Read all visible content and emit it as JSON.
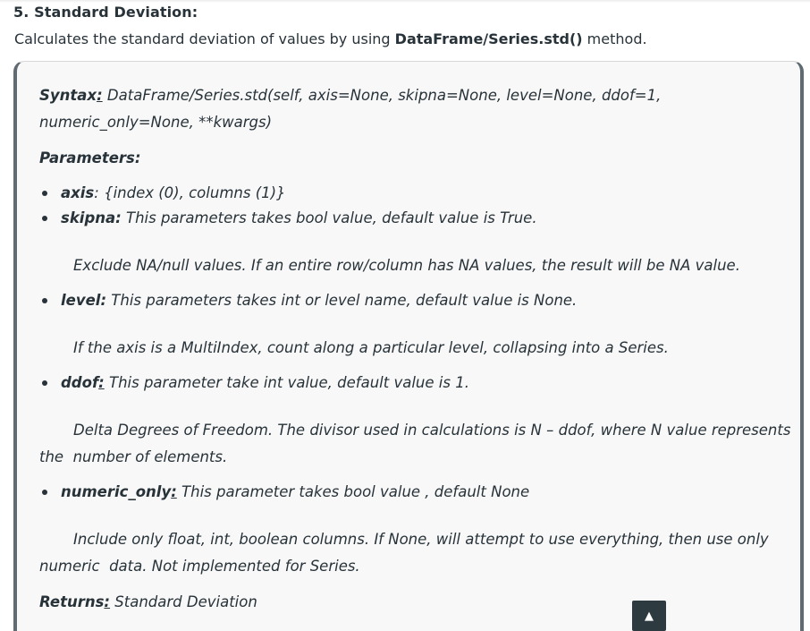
{
  "section": {
    "title": "5. Standard Deviation:",
    "intro_before": "Calculates the standard deviation of values by using ",
    "intro_code": "DataFrame/Series.std()",
    "intro_after": " method."
  },
  "syntax": {
    "label": "Syntax",
    "colon": ":",
    "line1": " DataFrame/Series.std(self, axis=None, skipna=None, level=None, ddof=1,",
    "line2": "numeric_only=None, **kwargs)"
  },
  "parameters_label": "Parameters:",
  "params": [
    {
      "name": "axis",
      "sep": ":",
      "text": " {index (0), columns (1)}"
    },
    {
      "name": "skipna:",
      "sep": "",
      "text": " This parameters takes bool value, default value is True.",
      "desc": "Exclude NA/null values. If an entire row/column has NA values, the result will be NA value."
    },
    {
      "name": "level:",
      "sep": "",
      "text": " This parameters takes int or level name, default value is None.",
      "desc": "If the axis is a MultiIndex, count along a particular level, collapsing into a Series."
    },
    {
      "name": "ddof",
      "sep": ":",
      "text": " This parameter take int value, default value is 1.",
      "desc1": "Delta Degrees of Freedom. The divisor used in calculations is N – ddof, where N value represents",
      "desc2": "the  number of elements."
    },
    {
      "name": "numeric_only",
      "sep": ":",
      "text": " This parameter takes bool value , default None",
      "desc1": "Include only float, int, boolean columns. If None, will attempt to use everything, then use only",
      "desc2": "numeric  data. Not implemented for Series."
    }
  ],
  "returns": {
    "label": "Returns",
    "colon": ":",
    "text": " Standard Deviation"
  },
  "scroll_top_icon": "▲"
}
